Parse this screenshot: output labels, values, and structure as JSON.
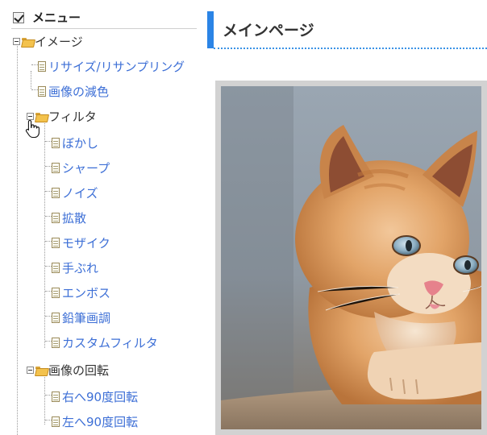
{
  "sidebar": {
    "menu_title": "メニュー",
    "tree": {
      "image_folder": "イメージ",
      "resize": "リサイズ/リサンプリング",
      "reduce_color": "画像の減色",
      "filter_folder": "フィルタ",
      "blur": "ぼかし",
      "sharpen": "シャープ",
      "noise": "ノイズ",
      "diffuse": "拡散",
      "mosaic": "モザイク",
      "shake": "手ぶれ",
      "emboss": "エンボス",
      "pencil": "鉛筆画調",
      "custom_filter": "カスタムフィルタ",
      "rotate_folder": "画像の回転",
      "rotate_right": "右へ90度回転",
      "rotate_left": "左へ90度回転"
    }
  },
  "main": {
    "title": "メインページ",
    "image_subject": "kitten-photo"
  },
  "colors": {
    "accent": "#2b84e6",
    "link": "#3d6fd6",
    "folder": "#f3c24d"
  }
}
